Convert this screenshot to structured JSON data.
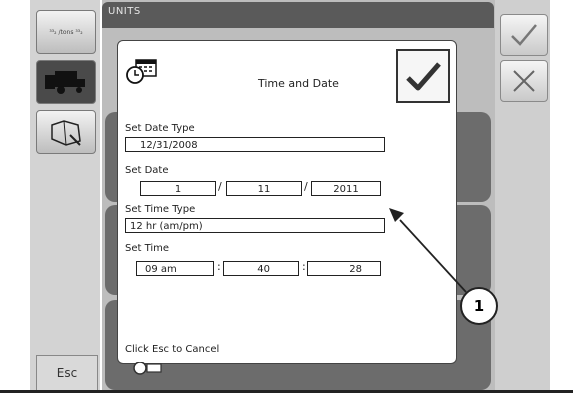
{
  "background": {
    "header_label": "UNITS"
  },
  "sidebar": {
    "units_label": "³³₂ /tons ³³₂",
    "esc_label": "Esc"
  },
  "dialog": {
    "title": "Time and Date",
    "date_type_label": "Set Date Type",
    "date_type_value": "12/31/2008",
    "date_label": "Set Date",
    "date_month": "1",
    "date_day": "11",
    "date_year": "2011",
    "time_type_label": "Set Time Type",
    "time_type_value": "12 hr (am/pm)",
    "time_label": "Set Time",
    "time_hour": "09 am",
    "time_minute": "40",
    "time_second": "28",
    "separator_slash": "/",
    "separator_colon": ":",
    "cancel_hint": "Click Esc to Cancel"
  },
  "callout": {
    "number": "1"
  },
  "icons": {
    "dialog_icon": "clock-calendar-icon",
    "confirm": "checkmark-icon",
    "cancel": "x-icon",
    "combine": "combine-harvester-icon",
    "field": "field-map-icon"
  }
}
